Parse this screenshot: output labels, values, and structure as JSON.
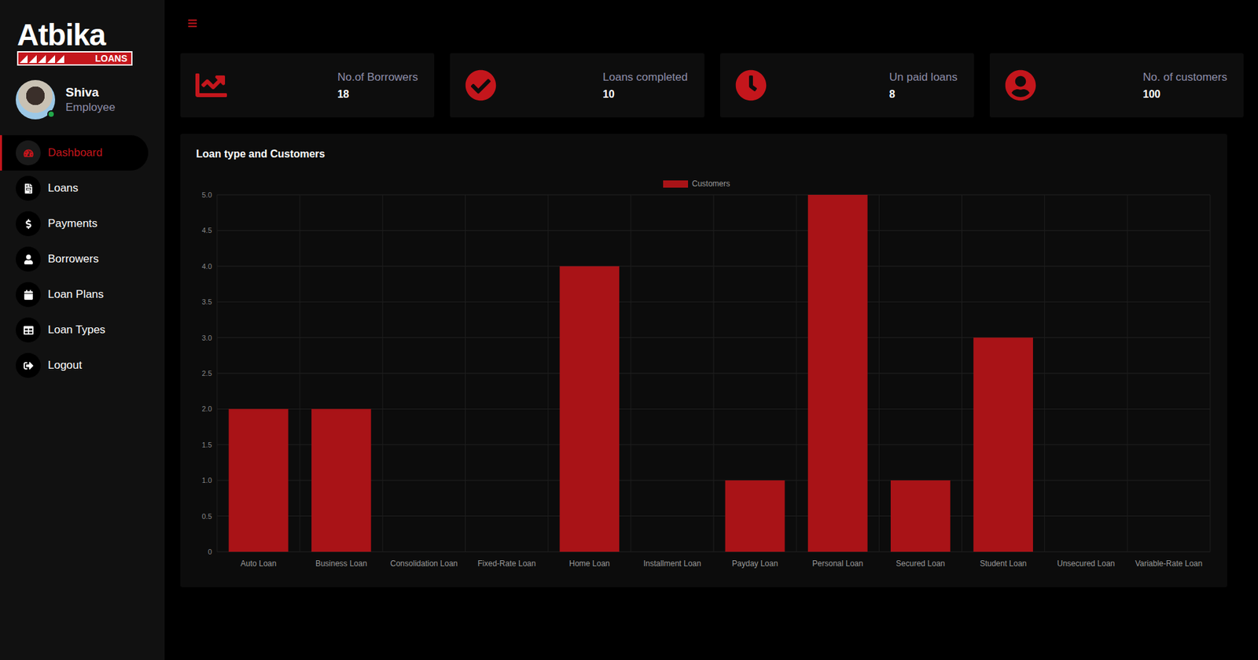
{
  "logo": {
    "name": "Atbika",
    "tag": "LOANS"
  },
  "user": {
    "name": "Shiva",
    "role": "Employee",
    "online": true
  },
  "sidebar": {
    "items": [
      {
        "label": "Dashboard",
        "selected": true
      },
      {
        "label": "Loans",
        "selected": false
      },
      {
        "label": "Payments",
        "selected": false
      },
      {
        "label": "Borrowers",
        "selected": false
      },
      {
        "label": "Loan Plans",
        "selected": false
      },
      {
        "label": "Loan Types",
        "selected": false
      },
      {
        "label": "Logout",
        "selected": false
      }
    ]
  },
  "stats": [
    {
      "label": "No.of Borrowers",
      "value": "18"
    },
    {
      "label": "Loans completed",
      "value": "10"
    },
    {
      "label": "Un paid loans",
      "value": "8"
    },
    {
      "label": "No. of customers",
      "value": "100"
    }
  ],
  "chart": {
    "title": "Loan type and Customers",
    "y_ticks": [
      "0",
      "0.5",
      "1.0",
      "1.5",
      "2.0",
      "2.5",
      "3.0",
      "3.5",
      "4.0",
      "4.5",
      "5.0"
    ],
    "categories": [
      "Auto Loan",
      "Business Loan",
      "Consolidation Loan",
      "Fixed-Rate Loan",
      "Home Loan",
      "Installment Loan",
      "Payday Loan",
      "Personal Loan",
      "Secured Loan",
      "Student Loan",
      "Unsecured Loan",
      "Variable-Rate Loan"
    ],
    "series": [
      {
        "name": "Customers",
        "values": [
          2,
          2,
          0,
          0,
          4,
          0,
          1,
          5,
          1,
          3,
          0,
          0
        ]
      }
    ]
  }
}
